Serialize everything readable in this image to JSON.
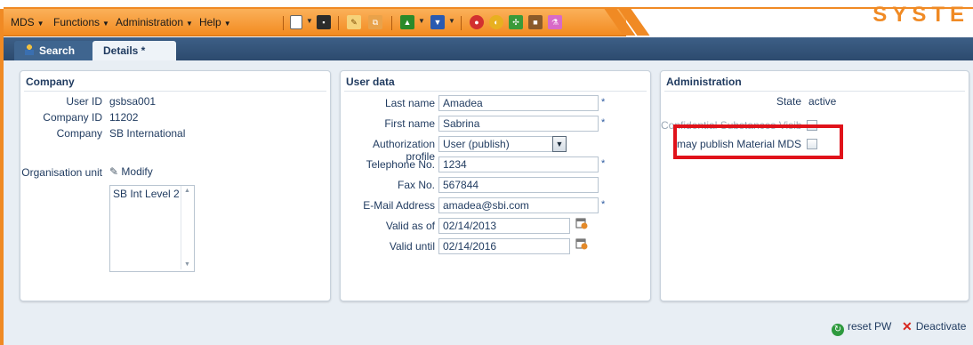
{
  "menubar": {
    "items": [
      {
        "label": "MDS"
      },
      {
        "label": "Functions"
      },
      {
        "label": "Administration"
      },
      {
        "label": "Help"
      }
    ],
    "logo_text": "SYSTE"
  },
  "tabs": [
    {
      "label": "Search",
      "icon": "user-icon"
    },
    {
      "label": "Details *"
    }
  ],
  "company": {
    "title": "Company",
    "user_id_label": "User ID",
    "user_id": "gsbsa001",
    "company_id_label": "Company ID",
    "company_id": "11202",
    "company_label": "Company",
    "company": "SB International",
    "org_unit_label": "Organisation unit",
    "modify_label": "Modify",
    "org_list": [
      "SB Int Level 2"
    ]
  },
  "user_data": {
    "title": "User data",
    "last_name_label": "Last name",
    "last_name": "Amadea",
    "first_name_label": "First name",
    "first_name": "Sabrina",
    "auth_label": "Authorization profile",
    "auth_value": "User (publish)",
    "phone_label": "Telephone No.",
    "phone": "1234",
    "fax_label": "Fax No.",
    "fax": "567844",
    "email_label": "E-Mail Address",
    "email": "amadea@sbi.com",
    "valid_from_label": "Valid as of",
    "valid_from": "02/14/2013",
    "valid_until_label": "Valid until",
    "valid_until": "02/14/2016",
    "required_mark": "*"
  },
  "administration": {
    "title": "Administration",
    "state_label": "State",
    "state": "active",
    "confidential_label": "Confidential Substances Visible",
    "publish_label": "may publish Material MDS"
  },
  "actions": {
    "reset_label": "reset PW",
    "deactivate_label": "Deactivate"
  },
  "colors": {
    "accent_orange": "#f08a24",
    "tab_blue": "#2c4a6e",
    "highlight_red": "#e0121a"
  }
}
